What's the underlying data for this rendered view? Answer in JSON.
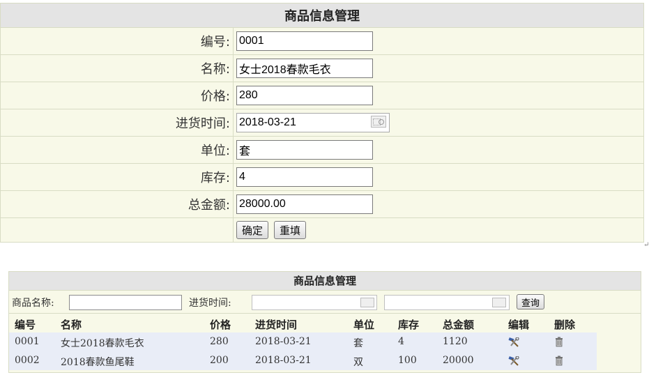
{
  "form": {
    "title": "商品信息管理",
    "fields": {
      "id": {
        "label": "编号:",
        "value": "0001"
      },
      "name": {
        "label": "名称:",
        "value": "女士2018春款毛衣"
      },
      "price": {
        "label": "价格:",
        "value": "280"
      },
      "purchase_time": {
        "label": "进货时间:",
        "value": "2018-03-21"
      },
      "unit": {
        "label": "单位:",
        "value": "套"
      },
      "stock": {
        "label": "库存:",
        "value": "4"
      },
      "total": {
        "label": "总金额:",
        "value": "28000.00"
      }
    },
    "confirm_label": "确定",
    "reset_label": "重填"
  },
  "search": {
    "title": "商品信息管理",
    "name_label": "商品名称:",
    "name_value": "",
    "time_label": "进货时间:",
    "date_from": "",
    "date_to": "",
    "query_label": "查询"
  },
  "list": {
    "headers": [
      "编号",
      "名称",
      "价格",
      "进货时间",
      "单位",
      "库存",
      "总金额",
      "编辑",
      "删除"
    ],
    "rows": [
      [
        "0001",
        "女士2018春款毛衣",
        "280",
        "2018-03-21",
        "套",
        "4",
        "1120"
      ],
      [
        "0002",
        "2018春款鱼尾鞋",
        "200",
        "2018-03-21",
        "双",
        "100",
        "20000"
      ]
    ],
    "icons": {
      "edit": "hammer-wrench-icon",
      "delete": "trash-can-icon"
    }
  },
  "colors": {
    "header_bg": "#e4e4e4",
    "panel_bg": "#f8f9e8",
    "row_bg": "#e9edf7"
  }
}
